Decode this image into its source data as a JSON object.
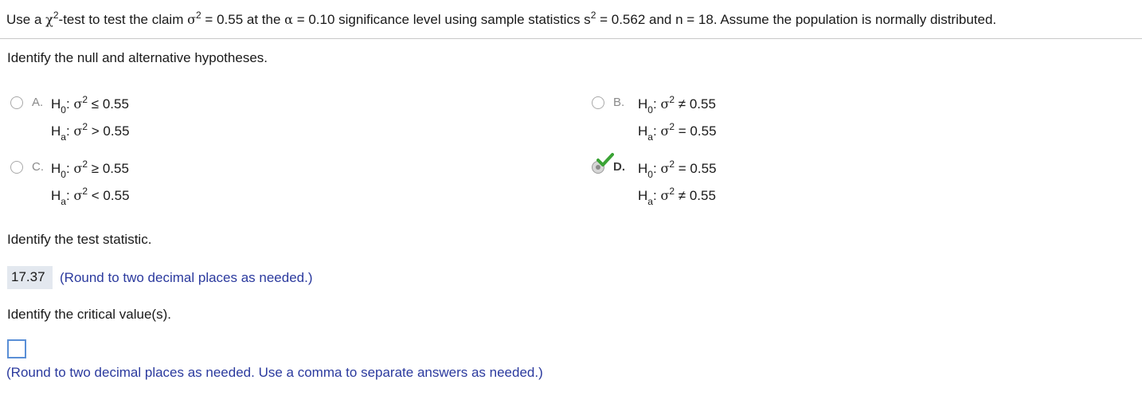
{
  "question": {
    "p1": "Use a ",
    "chi": "χ",
    "sq": "2",
    "p2": "-test to test the claim ",
    "sigma": "σ",
    "p3": " = 0.55 at the ",
    "alpha": "α",
    "p4": " = 0.10 significance level using sample statistics s",
    "p5": " = 0.562 and n = 18. Assume the population is normally distributed."
  },
  "prompts": {
    "hypotheses": "Identify the null and alternative hypotheses.",
    "test_statistic": "Identify the test statistic.",
    "critical_values": "Identify the critical value(s)."
  },
  "symbols": {
    "H": "H",
    "null_sub": "0",
    "alt_sub": "a",
    "colon": ":",
    "sigma": "σ",
    "sq": "2"
  },
  "options": [
    {
      "letter": "A.",
      "null_rel": "≤ 0.55",
      "alt_rel": "> 0.55",
      "selected": false
    },
    {
      "letter": "B.",
      "null_rel": "≠ 0.55",
      "alt_rel": "= 0.55",
      "selected": false
    },
    {
      "letter": "C.",
      "null_rel": "≥ 0.55",
      "alt_rel": "< 0.55",
      "selected": false
    },
    {
      "letter": "D.",
      "null_rel": "= 0.55",
      "alt_rel": "≠ 0.55",
      "selected": true
    }
  ],
  "test_statistic": {
    "value": "17.37",
    "hint": "(Round to two decimal places as needed.)"
  },
  "critical_values": {
    "value": "",
    "hint": "(Round to two decimal places as needed. Use a comma to separate answers as needed.)"
  },
  "colors": {
    "hint": "#2b3a9e",
    "check": "#3aa335",
    "input_border": "#5a8fd6",
    "answer_bg": "#e3e8ef"
  }
}
